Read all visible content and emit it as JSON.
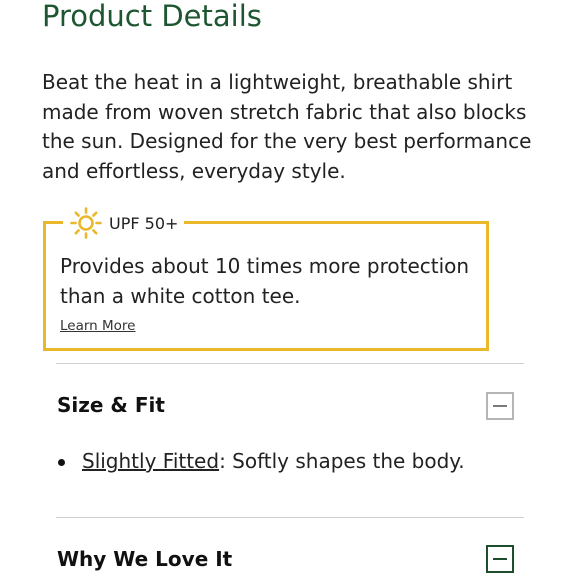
{
  "product_details": {
    "title": "Product Details",
    "description": "Beat the heat in a lightweight, breathable shirt made from woven stretch fabric that also blocks the sun. Designed for the very best performance and effortless, everyday style."
  },
  "upf_callout": {
    "icon": "sun-icon",
    "label": "UPF 50+",
    "text": "Provides about 10 times more protection than a white cotton tee.",
    "link_label": "Learn More"
  },
  "size_fit": {
    "heading": "Size & Fit",
    "toggle_icon": "minus-icon",
    "item_link": "Slightly Fitted",
    "item_text": ": Softly shapes the body."
  },
  "why_we_love_it": {
    "heading": "Why We Love It",
    "toggle_icon": "minus-icon"
  },
  "colors": {
    "title_green": "#1e5631",
    "upf_border": "#e9b82b",
    "sun_icon": "#e9b82b",
    "toggle_dark": "#1e4d2b",
    "divider": "#cfcfcf"
  }
}
